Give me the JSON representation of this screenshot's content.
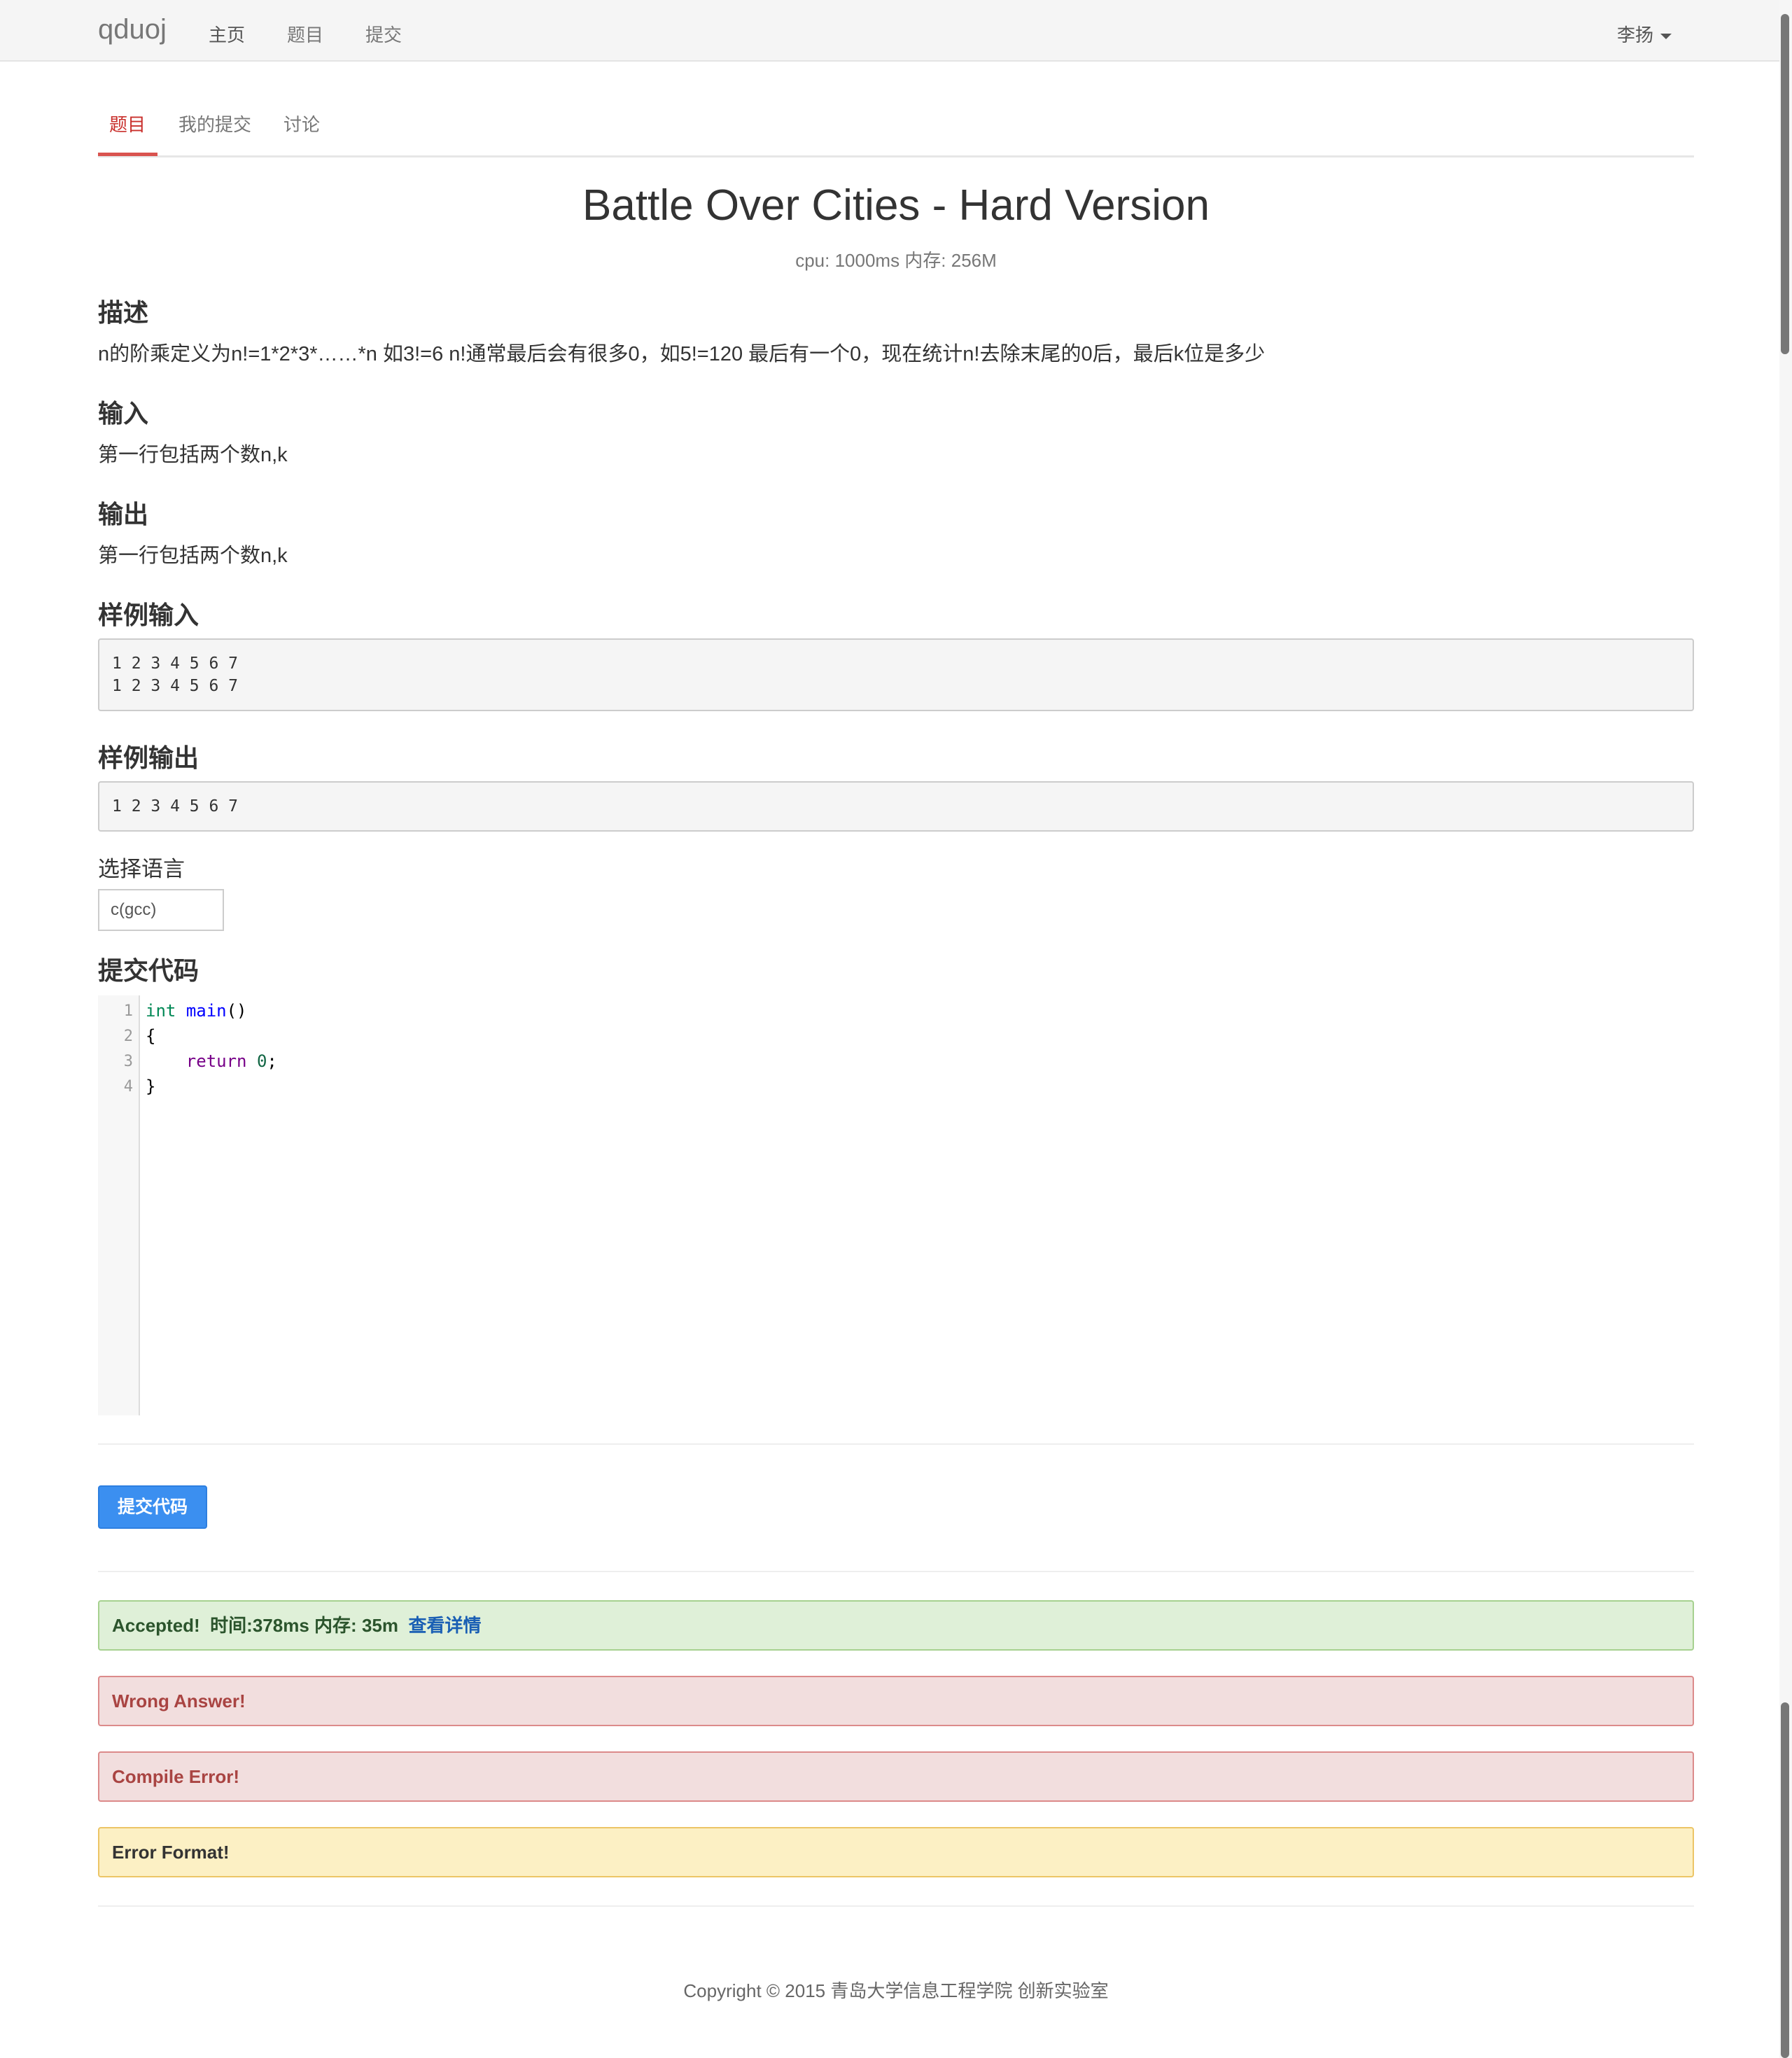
{
  "navbar": {
    "brand": "qduoj",
    "links": [
      "主页",
      "题目",
      "提交"
    ],
    "user": "李扬"
  },
  "tabs": [
    "题目",
    "我的提交",
    "讨论"
  ],
  "problem": {
    "title": "Battle Over Cities - Hard Version",
    "limits": "cpu: 1000ms 内存: 256M",
    "sections": {
      "description": {
        "heading": "描述",
        "text": "n的阶乘定义为n!=1*2*3*……*n 如3!=6 n!通常最后会有很多0，如5!=120 最后有一个0，现在统计n!去除末尾的0后，最后k位是多少"
      },
      "input": {
        "heading": "输入",
        "text": "第一行包括两个数n,k"
      },
      "output": {
        "heading": "输出",
        "text": "第一行包括两个数n,k"
      },
      "sample_input": {
        "heading": "样例输入",
        "text": "1 2 3 4 5 6 7\n1 2 3 4 5 6 7"
      },
      "sample_output": {
        "heading": "样例输出",
        "text": "1 2 3 4 5 6 7"
      }
    }
  },
  "language": {
    "label": "选择语言",
    "selected": "c(gcc)"
  },
  "code": {
    "heading": "提交代码",
    "line_numbers": [
      "1",
      "2",
      "3",
      "4"
    ],
    "tokens": {
      "type": "int",
      "func": "main",
      "parens": "()",
      "open": "{",
      "ret": "return",
      "zero": "0",
      "semi": ";",
      "close": "}"
    }
  },
  "submit_label": "提交代码",
  "results": {
    "accepted": {
      "status": "Accepted!",
      "time_label": "时间:",
      "time": "378ms",
      "mem_label": "内存:",
      "mem": "35m",
      "link": "查看详情"
    },
    "wrong": "Wrong Answer!",
    "compile_error": "Compile Error!",
    "format_error": "Error Format!"
  },
  "footer": "Copyright © 2015 青岛大学信息工程学院 创新实验室"
}
